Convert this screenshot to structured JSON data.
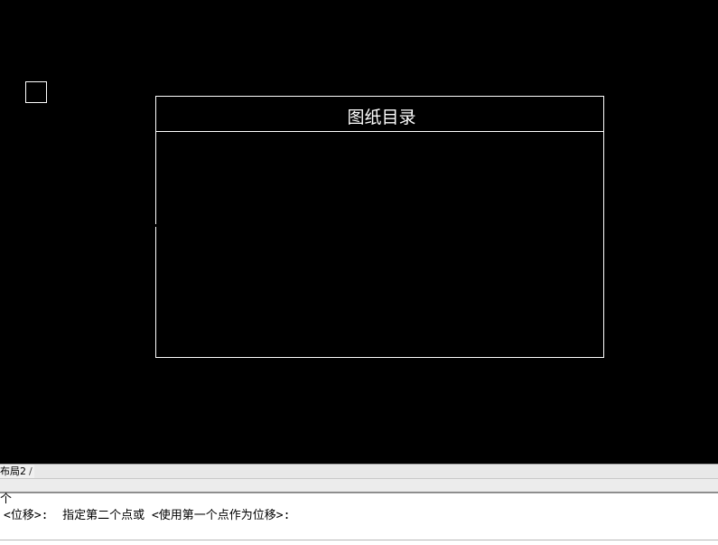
{
  "canvas": {
    "background": "#000000",
    "line_color": "#ffffff",
    "title_block": {
      "title": "图纸目录"
    }
  },
  "layout_tabs": {
    "active_tab": "布局2",
    "separator": "/"
  },
  "command_line": {
    "history_line": "个",
    "prompt_line": "<位移>:  指定第二个点或 <使用第一个点作为位移>:"
  }
}
